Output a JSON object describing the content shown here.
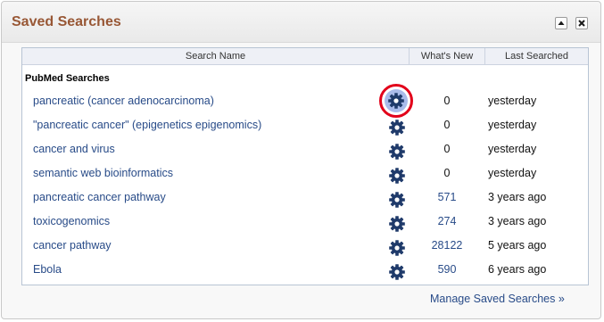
{
  "panel": {
    "title": "Saved Searches",
    "collapse_icon": "triangle-up-icon",
    "close_icon": "close-icon"
  },
  "table": {
    "columns": [
      "Search Name",
      "What's New",
      "Last Searched"
    ],
    "section_title": "PubMed Searches",
    "rows": [
      {
        "name": "pancreatic (cancer adenocarcinoma)",
        "whats_new": "0",
        "last_searched": "yesterday",
        "highlighted": true
      },
      {
        "name": "\"pancreatic cancer\" (epigenetics epigenomics)",
        "whats_new": "0",
        "last_searched": "yesterday"
      },
      {
        "name": "cancer and virus",
        "whats_new": "0",
        "last_searched": "yesterday"
      },
      {
        "name": "semantic web bioinformatics",
        "whats_new": "0",
        "last_searched": "yesterday"
      },
      {
        "name": "pancreatic cancer pathway",
        "whats_new": "571",
        "last_searched": "3 years ago"
      },
      {
        "name": "toxicogenomics",
        "whats_new": "274",
        "last_searched": "3 years ago"
      },
      {
        "name": "cancer pathway",
        "whats_new": "28122",
        "last_searched": "5 years ago"
      },
      {
        "name": "Ebola",
        "whats_new": "590",
        "last_searched": "6 years ago"
      }
    ]
  },
  "footer": {
    "manage_link": "Manage Saved Searches »"
  },
  "colors": {
    "title": "#985735",
    "link": "#284b88",
    "gear": "#1f3a6a",
    "highlight_ring": "#e2001a",
    "highlight_fill": "#aabbea"
  }
}
